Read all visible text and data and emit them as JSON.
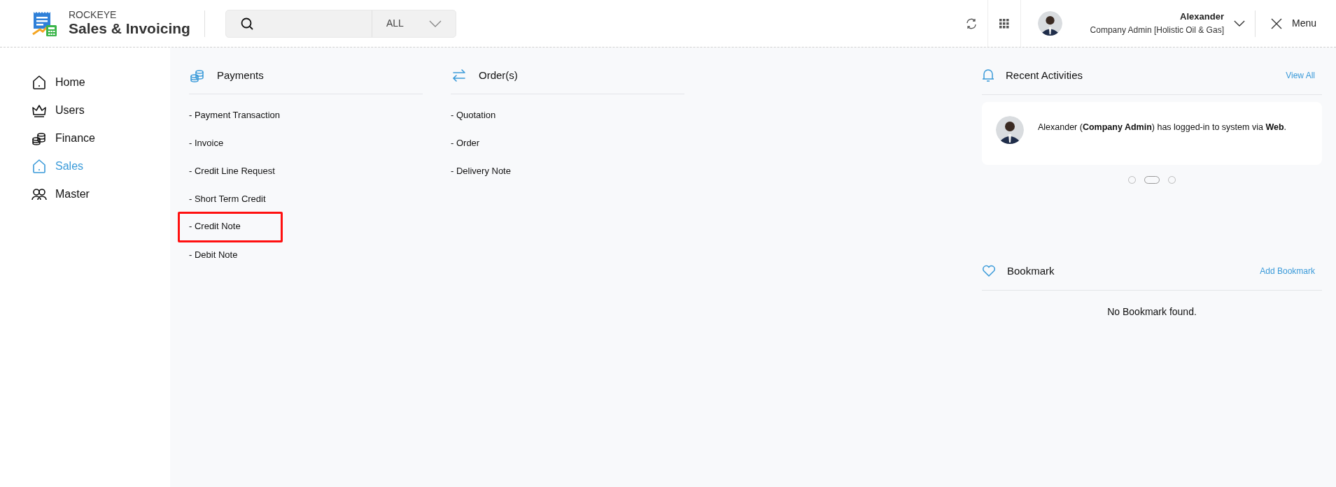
{
  "app": {
    "brand": "ROCKEYE",
    "title": "Sales & Invoicing"
  },
  "search": {
    "scope": "ALL"
  },
  "user": {
    "name": "Alexander",
    "role": "Company Admin [Holistic Oil & Gas]"
  },
  "menu_button": {
    "label": "Menu"
  },
  "sidebar": {
    "items": [
      {
        "label": "Home",
        "kind": "home",
        "selected": false
      },
      {
        "label": "Users",
        "kind": "crown",
        "selected": false
      },
      {
        "label": "Finance",
        "kind": "coins",
        "selected": false
      },
      {
        "label": "Sales",
        "kind": "home",
        "selected": true
      },
      {
        "label": "Master",
        "kind": "people",
        "selected": false
      }
    ]
  },
  "sections": [
    {
      "title": "Payments",
      "kind": "coins",
      "items": [
        {
          "label": "- Payment Transaction",
          "highlighted": false
        },
        {
          "label": "- Invoice",
          "highlighted": false
        },
        {
          "label": "- Credit Line Request",
          "highlighted": false
        },
        {
          "label": "- Short Term Credit",
          "highlighted": false
        },
        {
          "label": "- Credit Note",
          "highlighted": true
        },
        {
          "label": "- Debit Note",
          "highlighted": false
        }
      ]
    },
    {
      "title": "Order(s)",
      "kind": "swap",
      "items": [
        {
          "label": "- Quotation",
          "highlighted": false
        },
        {
          "label": "- Order",
          "highlighted": false
        },
        {
          "label": "- Delivery Note",
          "highlighted": false
        }
      ]
    }
  ],
  "recent_activities": {
    "title": "Recent Activities",
    "link": "View All",
    "items": [
      {
        "text": "Alexander (**Company Admin**) has logged-in to system via **Web**."
      }
    ],
    "pager": [
      {
        "selected": false
      },
      {
        "selected": true
      },
      {
        "selected": false
      }
    ]
  },
  "bookmark": {
    "title": "Bookmark",
    "link": "Add Bookmark",
    "empty": "No Bookmark found."
  }
}
